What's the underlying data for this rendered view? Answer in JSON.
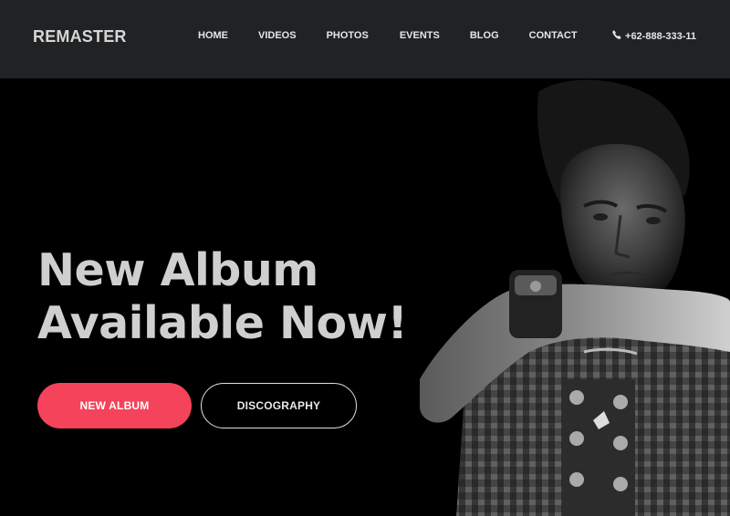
{
  "brand": {
    "logo_text": "REMASTER"
  },
  "nav": {
    "items": [
      {
        "label": "HOME"
      },
      {
        "label": "VIDEOS"
      },
      {
        "label": "PHOTOS"
      },
      {
        "label": "EVENTS"
      },
      {
        "label": "BLOG"
      },
      {
        "label": "CONTACT"
      }
    ],
    "phone": "+62-888-333-11",
    "phone_icon": "phone-icon"
  },
  "hero": {
    "headline_line1": "New Album",
    "headline_line2": "Available Now!",
    "primary_button": "NEW ALBUM",
    "secondary_button": "DISCOGRAPHY",
    "photo": "monochrome-portrait-of-young-guitarist"
  },
  "colors": {
    "navbar_bg": "#212224",
    "hero_bg": "#000000",
    "accent": "#f4435a",
    "text_light": "#cfcfcf"
  }
}
